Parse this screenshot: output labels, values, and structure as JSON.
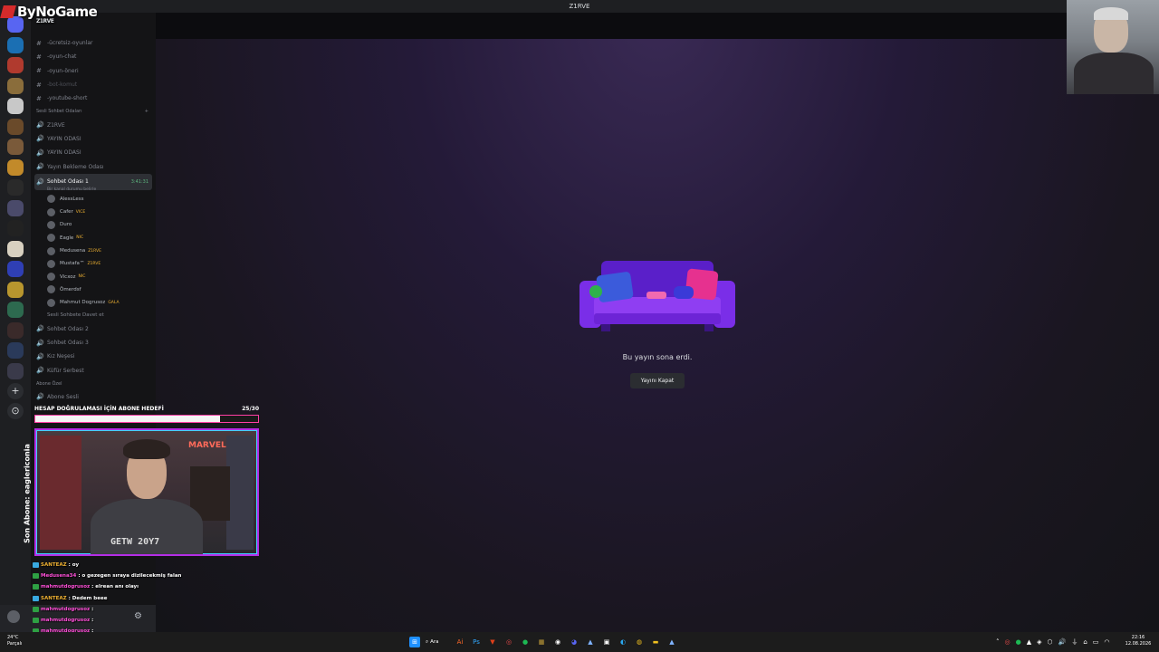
{
  "window": {
    "title": "Z1RVE"
  },
  "overlay_logo": {
    "text": "ByNoGame",
    "server_name": "Z1RVE"
  },
  "channels": {
    "text": [
      {
        "label": "-ücretsiz-oyunlar",
        "icon": "hash-icon"
      },
      {
        "label": "-oyun-chat",
        "icon": "hash-icon"
      },
      {
        "label": "-oyun-önerі",
        "icon": "hash-icon"
      },
      {
        "label": "-bot-komut",
        "icon": "hash-icon",
        "dim": true
      },
      {
        "label": "-youtube-short",
        "icon": "hash-icon"
      }
    ],
    "voice_category": "Sesli Sohbet Odaları",
    "voice_top": [
      {
        "label": "Z1RVE"
      },
      {
        "label": "YAYIN ODASI"
      },
      {
        "label": "YAYIN ODASI"
      },
      {
        "label": "Yayın Bekleme Odası"
      }
    ],
    "active_channel": {
      "label": "Sohbet Odası 1",
      "time": "3:41:31",
      "status": "Bir kanal durumu belirle"
    },
    "members": [
      {
        "name": "AlessLess",
        "tag": ""
      },
      {
        "name": "Cafer",
        "tag": "VICE"
      },
      {
        "name": "Duro",
        "tag": ""
      },
      {
        "name": "Eagle",
        "tag": "NIC"
      },
      {
        "name": "Medusena",
        "tag": "Z1RVE"
      },
      {
        "name": "Mustafa™",
        "tag": "Z1RVE"
      },
      {
        "name": "Vicxoz",
        "tag": "NIC"
      },
      {
        "name": "Ömerdsf",
        "tag": ""
      },
      {
        "name": "Mahmut Dogrusoz",
        "tag": "GALA"
      }
    ],
    "invite": "Sesli Sohbete Davet et",
    "voice_bottom": [
      {
        "label": "Sohbet Odası 2"
      },
      {
        "label": "Sohbet Odası 3"
      },
      {
        "label": "Kız Neşesi"
      },
      {
        "label": "Küfür Serbest"
      }
    ],
    "private_category": "Abone Özel",
    "private_item": "Abone Sesli"
  },
  "stream": {
    "ended_text": "Bu yayın sona erdi.",
    "close_button": "Yayını Kapat"
  },
  "overlay": {
    "goal_title": "HESAP DOĞRULAMASI İÇİN ABONE HEDEFİ",
    "goal_count": "25/30",
    "goal_progress": 0.83,
    "last_sub": "Son Abone: eaglericonia",
    "cam_sign": "MARVEL",
    "cam_shirt": "GETW 20Y7"
  },
  "chat": [
    {
      "user": "SANTEAZ",
      "text": "oy",
      "badge": "blue"
    },
    {
      "user": "Medusena34",
      "text": "o gezegen sıraya dizilecekmiş falan",
      "badge": "green"
    },
    {
      "user": "mahmutdogrusoz",
      "text": "elrean anı olayı",
      "badge": "green"
    },
    {
      "user": "SANTEAZ",
      "text": "Dedem beee",
      "badge": "blue"
    },
    {
      "user": "mahmutdogrusoz",
      "text": "",
      "badge": "green"
    },
    {
      "user": "mahmutdogrusoz",
      "text": "",
      "badge": "green"
    },
    {
      "user": "mahmutdogrusoz",
      "text": "",
      "badge": "green"
    },
    {
      "user": "mahmutdogrusoz",
      "text": "",
      "badge": "green"
    }
  ],
  "taskbar": {
    "weather_temp": "24°C",
    "weather_desc": "Parçalı",
    "search_label": "Ara",
    "time": "22:16",
    "date": "12.08.2026"
  },
  "colors": {
    "accent": "#b42ee6",
    "progress_border": "#ff3fa4",
    "stage_bg": "#241a38"
  }
}
